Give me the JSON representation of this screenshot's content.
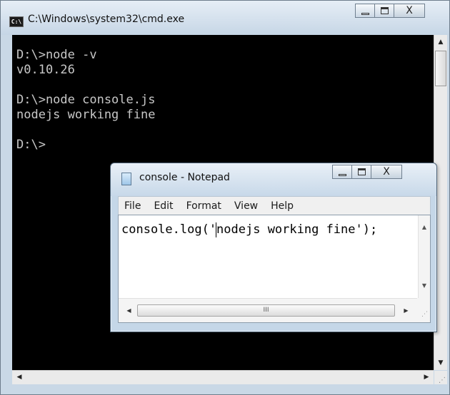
{
  "cmd_window": {
    "title": "C:\\Windows\\system32\\cmd.exe",
    "icon_label": "C:\\",
    "console_lines": [
      "D:\\>node -v",
      "v0.10.26",
      "",
      "D:\\>node console.js",
      "nodejs working fine",
      "",
      "D:\\>"
    ],
    "colors": {
      "console_bg": "#000000",
      "console_text": "#c8c8c8"
    }
  },
  "notepad_window": {
    "title": "console - Notepad",
    "menu": [
      "File",
      "Edit",
      "Format",
      "View",
      "Help"
    ],
    "content": "console.log('nodejs working fine');",
    "scroll_thumb_glyph": "III"
  },
  "controls": {
    "minimize_icon": "minimize-icon",
    "maximize_icon": "maximize-icon",
    "close_glyph": "X"
  },
  "scroll_glyphs": {
    "up": "▲",
    "down": "▼",
    "left": "◀",
    "right": "▶"
  }
}
